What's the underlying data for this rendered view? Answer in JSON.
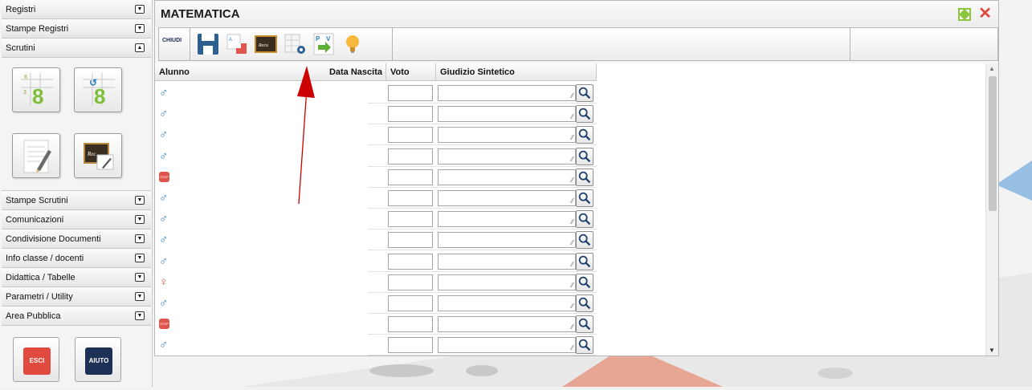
{
  "sidebar": {
    "top_sections": [
      {
        "label": "Registri",
        "state": "collapsed"
      },
      {
        "label": "Stampe Registri",
        "state": "collapsed"
      },
      {
        "label": "Scrutini",
        "state": "expanded"
      }
    ],
    "scrutini_tiles": [
      {
        "icon": "voti-proposti-icon",
        "glyph": "8"
      },
      {
        "icon": "voti-finali-icon",
        "glyph": "8"
      },
      {
        "icon": "giudizi-pencil-icon"
      },
      {
        "icon": "recupero-board-icon"
      }
    ],
    "bottom_sections": [
      {
        "label": "Stampe Scrutini"
      },
      {
        "label": "Comunicazioni"
      },
      {
        "label": "Condivisione Documenti"
      },
      {
        "label": "Info classe / docenti"
      },
      {
        "label": "Didattica / Tabelle"
      },
      {
        "label": "Parametri / Utility"
      },
      {
        "label": "Area Pubblica"
      }
    ],
    "exit_label": "ESCI",
    "help_label": "AIUTO"
  },
  "window": {
    "title": "MATEMATICA",
    "toolbar": {
      "close_label": "CHIUDI",
      "buttons": [
        "save-icon",
        "import-icon",
        "recupero-icon",
        "grid-settings-icon",
        "pv-icon",
        "lightbulb-icon"
      ]
    }
  },
  "grid": {
    "columns": {
      "alunno": "Alunno",
      "data_nascita": "Data Nascita",
      "voto": "Voto",
      "giudizio": "Giudizio Sintetico"
    },
    "rows": [
      {
        "gender": "male",
        "symbol": "♂"
      },
      {
        "gender": "male",
        "symbol": "♂"
      },
      {
        "gender": "male",
        "symbol": "♂"
      },
      {
        "gender": "male",
        "symbol": "♂"
      },
      {
        "gender": "stop",
        "symbol": "STOP"
      },
      {
        "gender": "male",
        "symbol": "♂"
      },
      {
        "gender": "male",
        "symbol": "♂"
      },
      {
        "gender": "male",
        "symbol": "♂"
      },
      {
        "gender": "male",
        "symbol": "♂"
      },
      {
        "gender": "female",
        "symbol": "♀"
      },
      {
        "gender": "male",
        "symbol": "♂"
      },
      {
        "gender": "stop",
        "symbol": "STOP"
      },
      {
        "gender": "male",
        "symbol": "♂"
      }
    ]
  },
  "colors": {
    "male": "#2e7fbf",
    "female": "#e0564e",
    "exit_button": "#e14b3f",
    "help_button": "#1d3157",
    "annotation_arrow": "#cc0000"
  }
}
